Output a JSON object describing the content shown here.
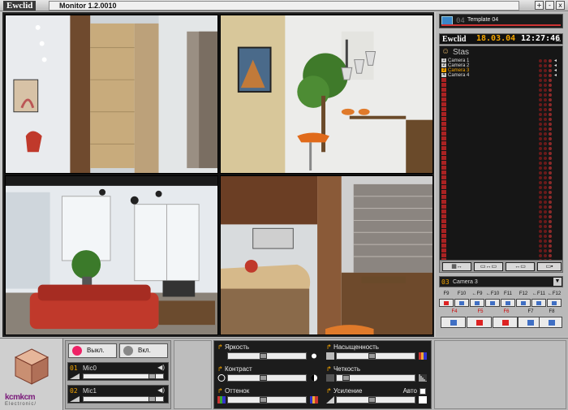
{
  "app": {
    "brand": "Ewclid",
    "title": "Monitor 1.2.0010",
    "window_buttons": [
      "+",
      "-",
      "x"
    ]
  },
  "cameras_view": [
    {
      "scene": "hallway-with-door"
    },
    {
      "scene": "living-room-with-plant"
    },
    {
      "scene": "living-room-with-red-sofa"
    },
    {
      "scene": "kitchen-with-brick-wall"
    }
  ],
  "right_panel": {
    "template": {
      "number": "04",
      "name": "Template 04"
    },
    "clock": {
      "brand": "Ewclid",
      "date": "18.03.04",
      "time": "12:27:46",
      "up_icon": "triangle-up-icon"
    },
    "user": {
      "name": "Stas"
    },
    "camera_list": [
      {
        "num": "1",
        "name": "Camera 1",
        "state": "on"
      },
      {
        "num": "2",
        "name": "Camera 2",
        "state": "on"
      },
      {
        "num": "3",
        "name": "Camera 3",
        "state": "active"
      },
      {
        "num": "4",
        "name": "Camera 4",
        "state": "on"
      }
    ],
    "selected_camera": {
      "num": "03",
      "name": "Camera 3"
    },
    "fkeys_top": [
      "F9",
      "F10",
      "←F9",
      "←F10",
      "F11",
      "F12",
      "←F11",
      "←F12"
    ],
    "fkeys_bottom": [
      "F4",
      "F5",
      "F6",
      "F7",
      "F8"
    ]
  },
  "audio": {
    "off_label": "Выкл.",
    "on_label": "Вкл.",
    "mics": [
      {
        "num": "01",
        "name": "Mic0",
        "level": 0.9
      },
      {
        "num": "02",
        "name": "Mic1",
        "level": 0.9
      }
    ]
  },
  "video_controls": {
    "brightness": {
      "label": "Яркость",
      "value": 0.45
    },
    "saturation": {
      "label": "Насыщенность",
      "value": 0.45
    },
    "contrast": {
      "label": "Контраст",
      "value": 0.45
    },
    "sharpness": {
      "label": "Четкость",
      "value": 0.08
    },
    "hue": {
      "label": "Оттенок",
      "value": 0.45
    },
    "gain": {
      "label": "Усиление",
      "value": 0.45,
      "auto_label": "Авто"
    }
  },
  "logo": {
    "text": "kcmkcm",
    "sub": "Electronic/"
  },
  "colors": {
    "accent": "#f2a400",
    "alarm": "#aa2222",
    "panel_bg": "#161616"
  }
}
